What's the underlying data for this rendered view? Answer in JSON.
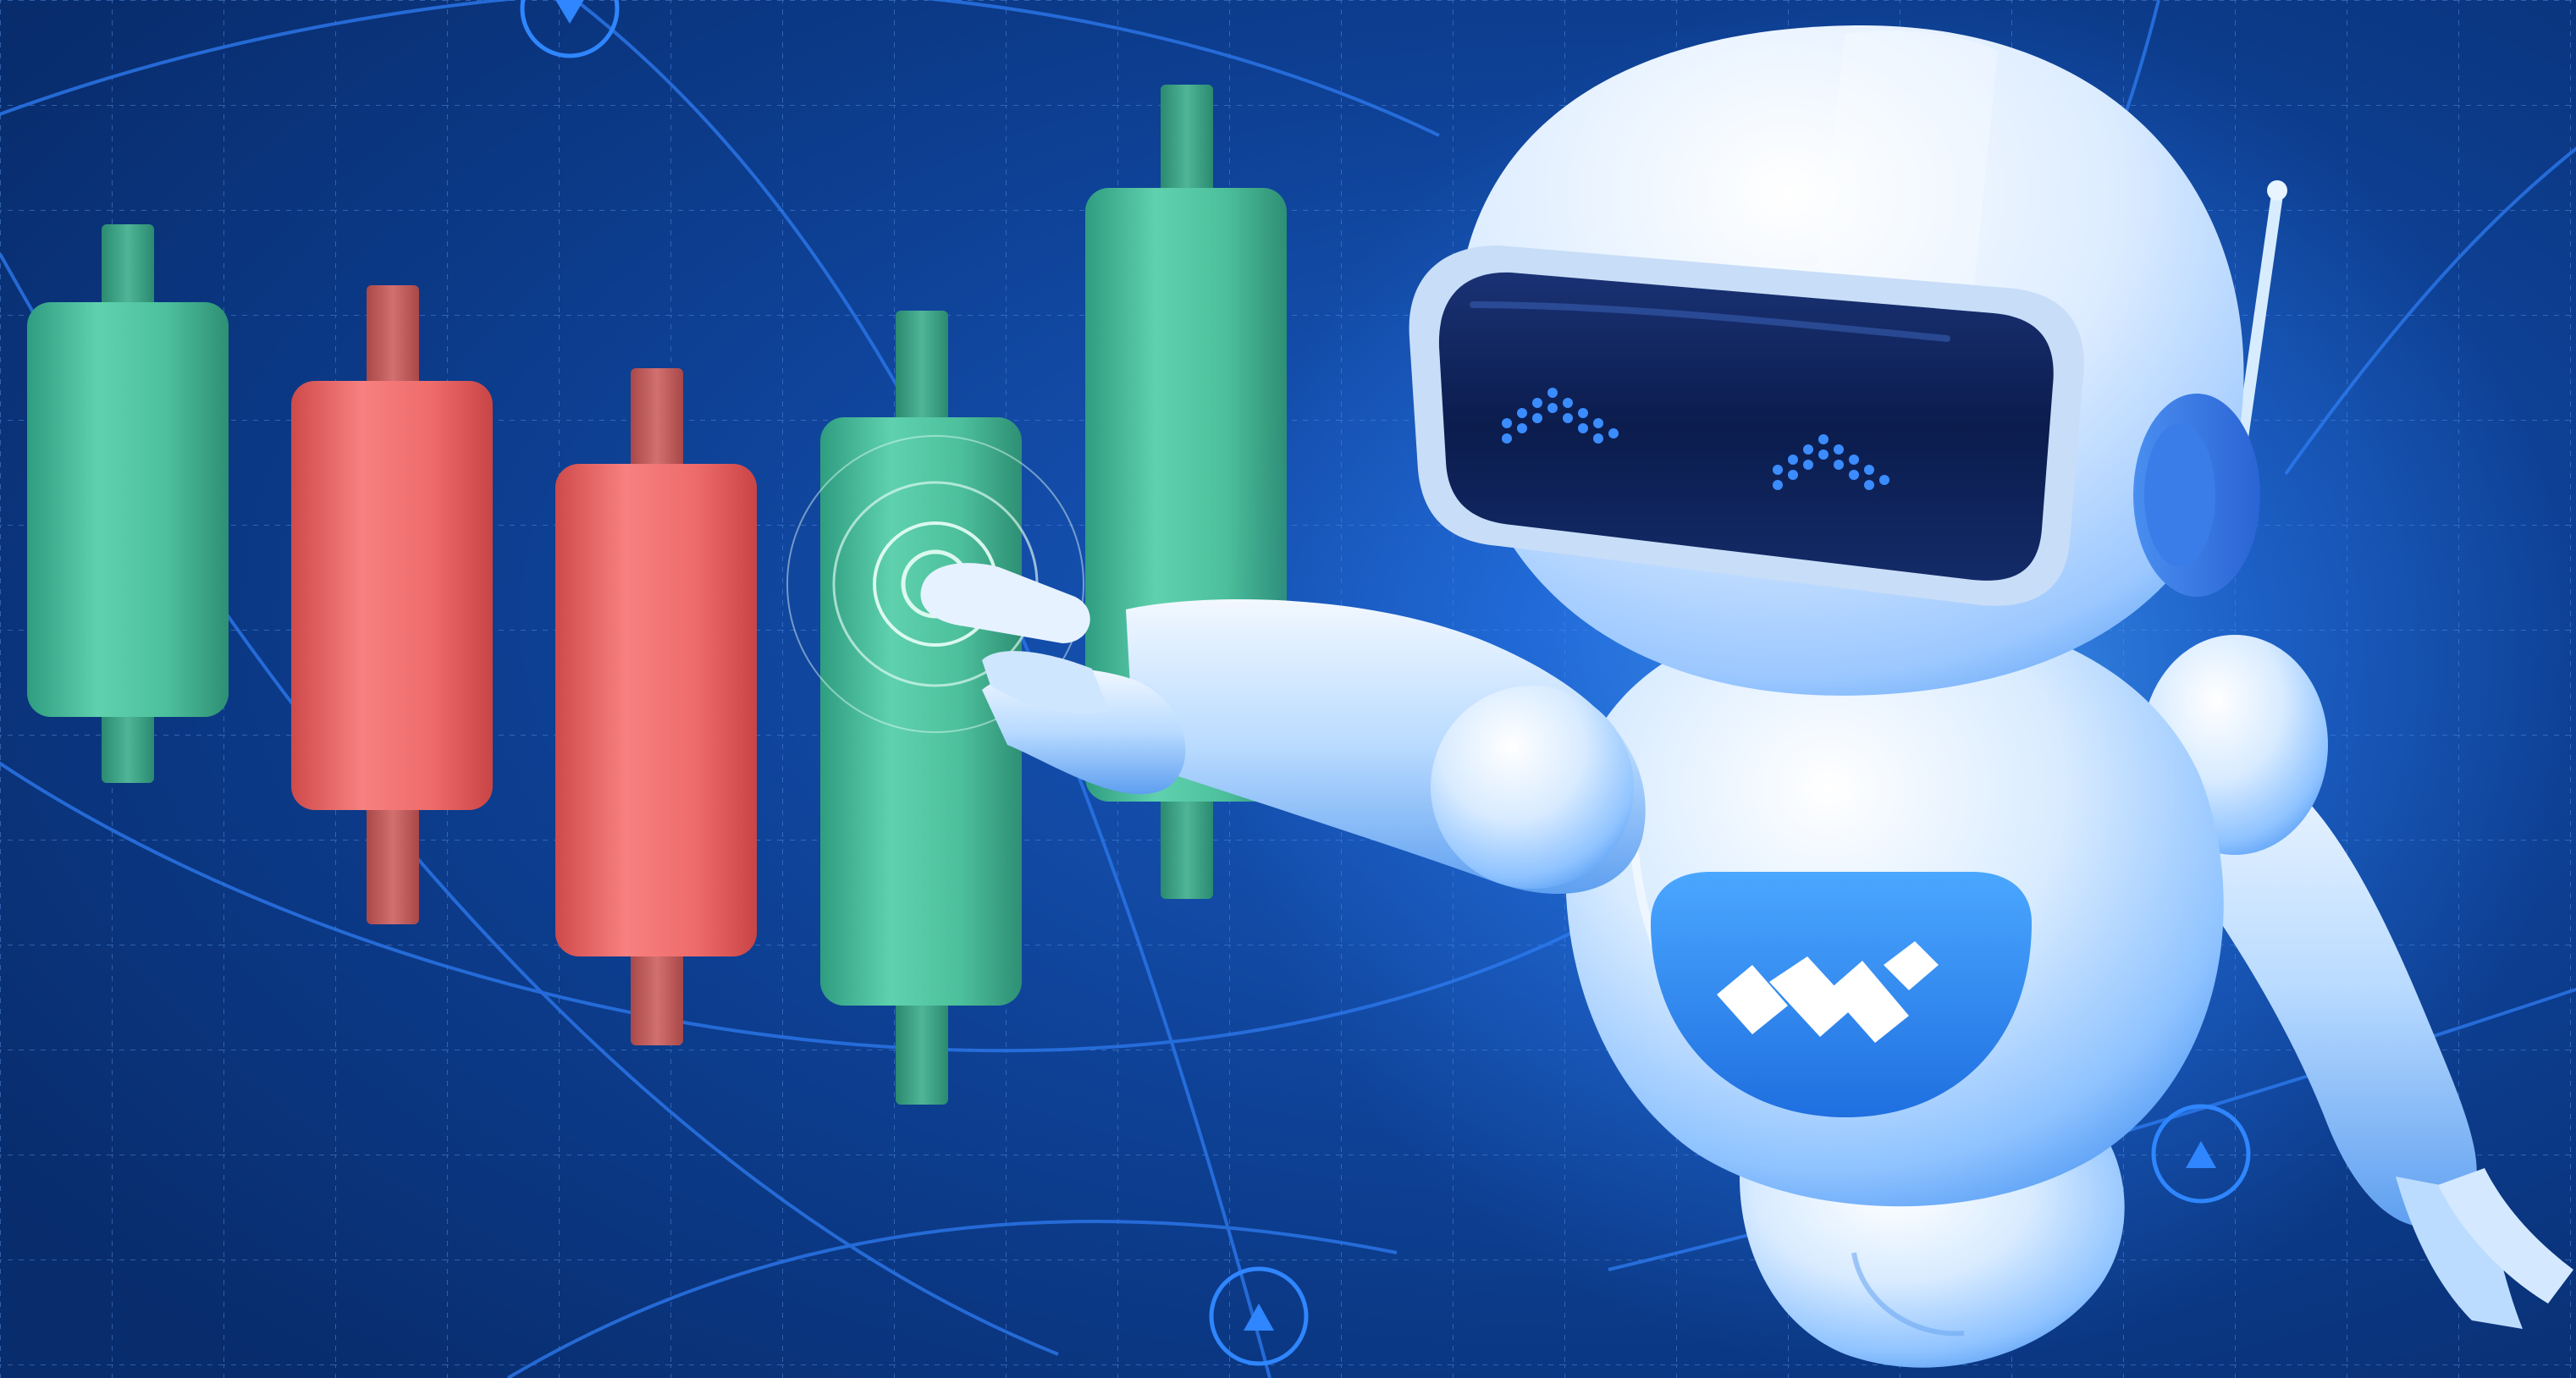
{
  "image": {
    "subject": "robot-touching-candlestick-chart",
    "colors": {
      "background": "#0b3a86",
      "background_light": "#1456b8",
      "grid": "#4f86d8",
      "orbit": "#2a74e6",
      "candle_up": "#4fc3a1",
      "candle_down": "#ee6b6b",
      "robot_body": "#cfe6ff",
      "robot_visor": "#0c1f52",
      "robot_glow": "#3aa0ff",
      "robot_eyes": "#3b8cff",
      "badge": "#2b7fe8"
    },
    "icons": {
      "badge_logo": "w-logo-icon",
      "markers": [
        "triangle-down-marker-icon",
        "triangle-up-marker-icon",
        "triangle-up-marker-icon"
      ]
    }
  },
  "candles": [
    {
      "direction": "up"
    },
    {
      "direction": "down"
    },
    {
      "direction": "down"
    },
    {
      "direction": "up"
    },
    {
      "direction": "up"
    }
  ]
}
